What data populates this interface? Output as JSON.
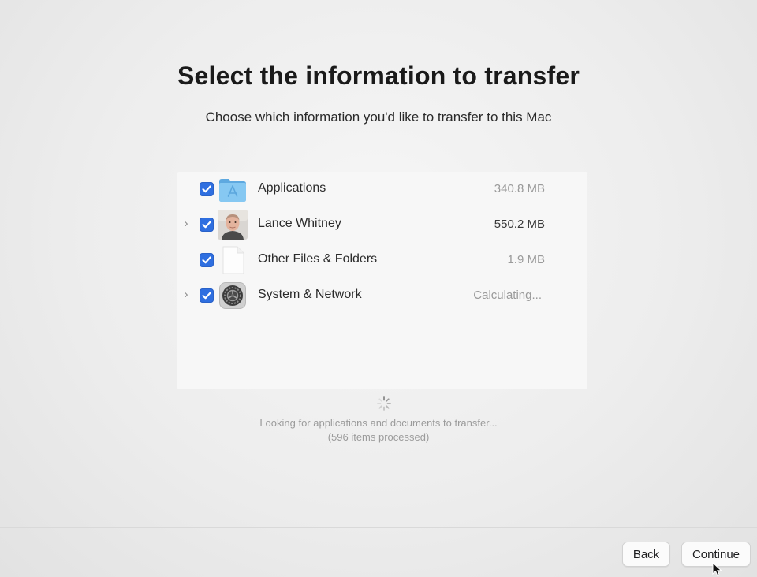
{
  "header": {
    "title": "Select the information to transfer",
    "subtitle": "Choose which information you'd like to transfer to this Mac"
  },
  "items": [
    {
      "label": "Applications",
      "size": "340.8 MB",
      "checked": true,
      "expandable": false,
      "icon": "applications-folder-icon"
    },
    {
      "label": "Lance Whitney",
      "size": "550.2 MB",
      "checked": true,
      "expandable": true,
      "icon": "user-avatar"
    },
    {
      "label": "Other Files & Folders",
      "size": "1.9 MB",
      "checked": true,
      "expandable": false,
      "icon": "document-icon"
    },
    {
      "label": "System & Network",
      "size": "Calculating...",
      "checked": true,
      "expandable": true,
      "icon": "system-settings-icon"
    }
  ],
  "status": {
    "line1": "Looking for applications and documents to transfer...",
    "line2": "(596 items processed)"
  },
  "footer": {
    "back_label": "Back",
    "continue_label": "Continue"
  },
  "colors": {
    "checkbox": "#2f6fe0",
    "folder": "#78c0ef"
  }
}
